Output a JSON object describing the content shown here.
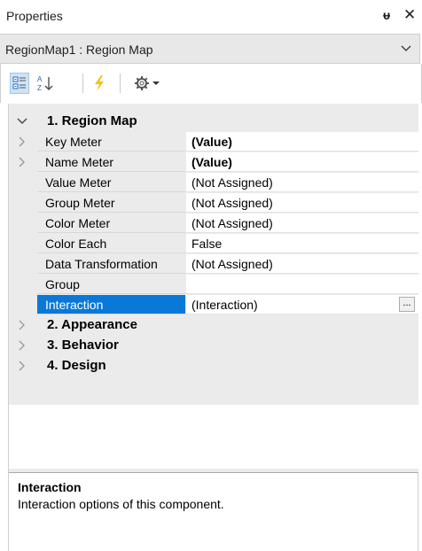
{
  "panel": {
    "title": "Properties",
    "pin_icon": "pin-icon",
    "close_icon": "close-icon"
  },
  "selector": {
    "value": "RegionMap1 : Region Map",
    "icon": "chevron-down-icon"
  },
  "toolbar": {
    "categorized_icon": "categorized-icon",
    "alphabetical_icon": "sort-alphabetical-icon",
    "events_icon": "lightning-icon",
    "settings_icon": "gear-icon"
  },
  "grid": {
    "categories": [
      {
        "label": "1. Region  Map",
        "expanded": true
      },
      {
        "label": "2. Appearance",
        "expanded": false
      },
      {
        "label": "3. Behavior",
        "expanded": false
      },
      {
        "label": "4. Design",
        "expanded": false
      }
    ],
    "properties": [
      {
        "name": "Key Meter",
        "value": "(Value)",
        "bold": true,
        "expandable": true
      },
      {
        "name": "Name Meter",
        "value": "(Value)",
        "bold": true,
        "expandable": true
      },
      {
        "name": "Value Meter",
        "value": "(Not Assigned)",
        "bold": false,
        "expandable": false
      },
      {
        "name": "Group Meter",
        "value": "(Not Assigned)",
        "bold": false,
        "expandable": false
      },
      {
        "name": "Color Meter",
        "value": "(Not Assigned)",
        "bold": false,
        "expandable": false
      },
      {
        "name": "Color Each",
        "value": "False",
        "bold": false,
        "expandable": false
      },
      {
        "name": "Data Transformation",
        "value": "(Not Assigned)",
        "bold": false,
        "expandable": false
      },
      {
        "name": "Group",
        "value": "",
        "bold": false,
        "expandable": false
      },
      {
        "name": "Interaction",
        "value": "(Interaction)",
        "bold": false,
        "expandable": false,
        "selected": true,
        "button": "..."
      }
    ]
  },
  "description": {
    "title": "Interaction",
    "text": "Interaction options of this component."
  },
  "colors": {
    "selection": "#0a78d7",
    "grid_background": "#ebebeb",
    "events_icon": "#f2c21b"
  }
}
